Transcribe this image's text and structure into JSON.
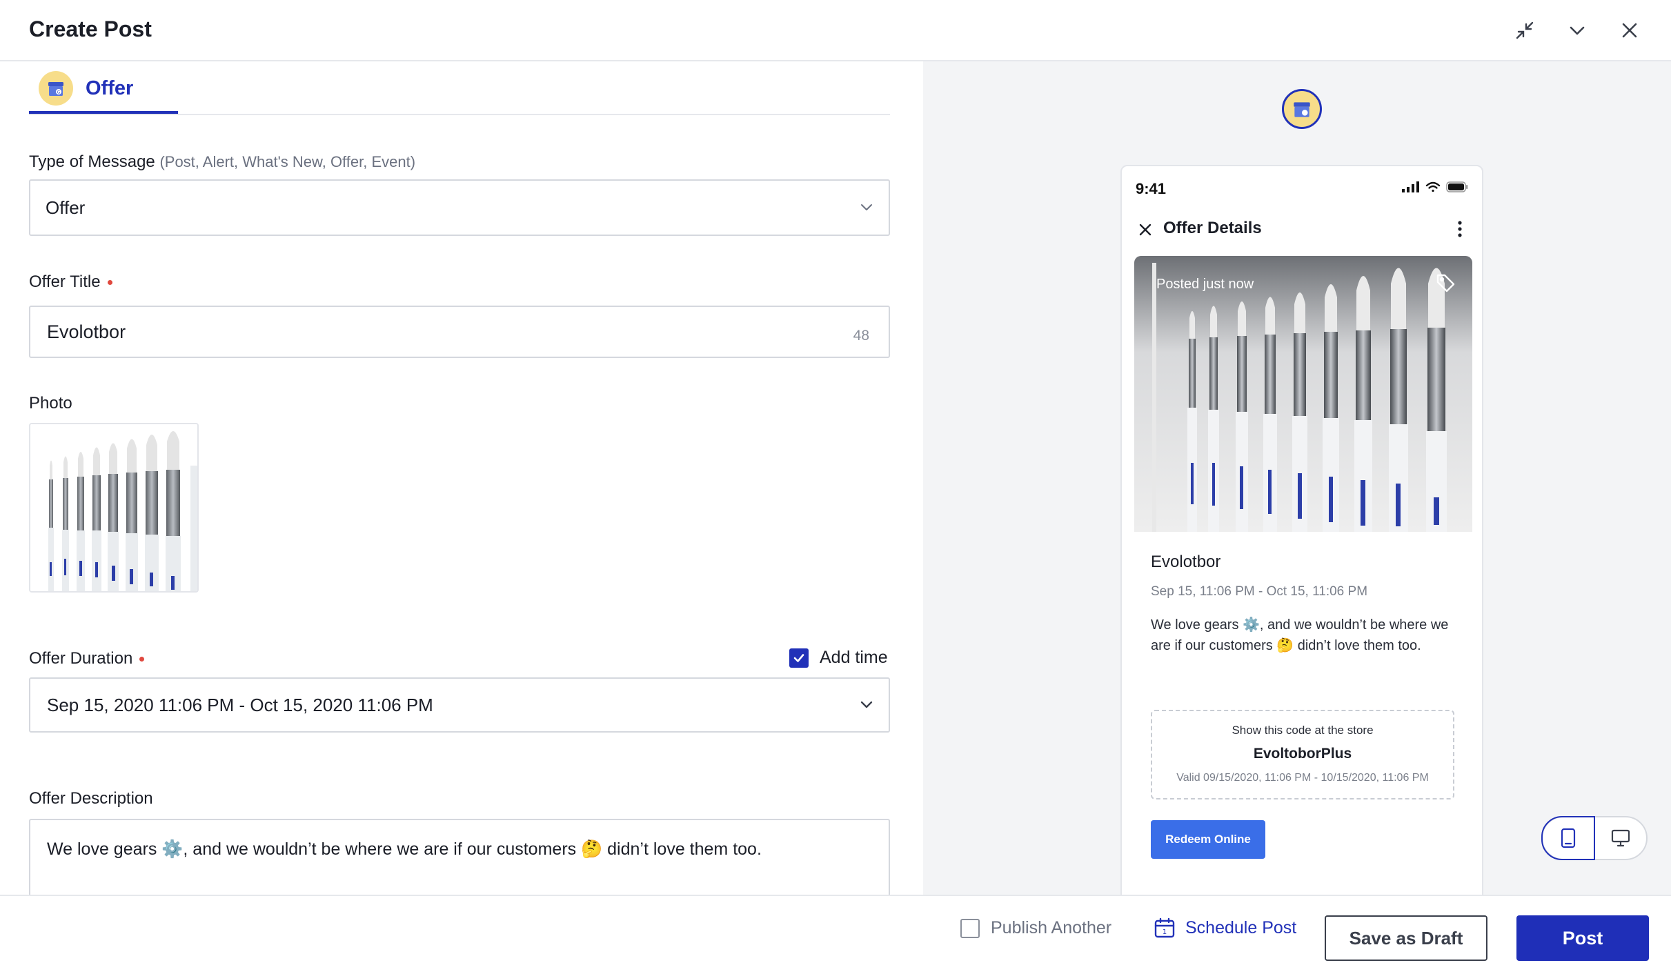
{
  "header": {
    "title": "Create Post",
    "actions": [
      "collapse-icon",
      "chevron-down-icon",
      "close-icon"
    ]
  },
  "tab": {
    "label": "Offer",
    "icon": "google-my-business-icon"
  },
  "form": {
    "message_type": {
      "label": "Type of Message",
      "hint": "(Post, Alert, What's New, Offer, Event)",
      "value": "Offer"
    },
    "offer_title": {
      "label": "Offer Title",
      "value": "Evolotbor",
      "char_count": "48"
    },
    "photo": {
      "label": "Photo"
    },
    "offer_duration": {
      "label": "Offer Duration",
      "add_time_label": "Add time",
      "add_time_checked": true,
      "value": "Sep 15, 2020 11:06 PM - Oct 15, 2020 11:06 PM"
    },
    "offer_description": {
      "label": "Offer Description",
      "value": "We love gears ⚙️, and we wouldn’t be where we are if our customers 🤔 didn’t love them too."
    }
  },
  "preview": {
    "status_time": "9:41",
    "header_title": "Offer Details",
    "posted": "Posted just now",
    "title": "Evolotbor",
    "dates": "Sep 15, 11:06 PM - Oct 15, 11:06 PM",
    "description": "We love gears ⚙️, and we wouldn’t be where we are if our customers 🤔 didn’t love them too.",
    "code_hint": "Show this code at the store",
    "code": "EvoltoborPlus",
    "code_valid": "Valid 09/15/2020, 11:06 PM - 10/15/2020, 11:06 PM",
    "redeem_label": "Redeem Online",
    "view_mode": "mobile"
  },
  "footer": {
    "publish_another": "Publish Another",
    "schedule": "Schedule Post",
    "save_draft": "Save as Draft",
    "post": "Post"
  },
  "colors": {
    "accent": "#2131b8",
    "required": "#e0483e",
    "redeem": "#3a6ee8",
    "preview_bg": "#f3f4f6"
  }
}
